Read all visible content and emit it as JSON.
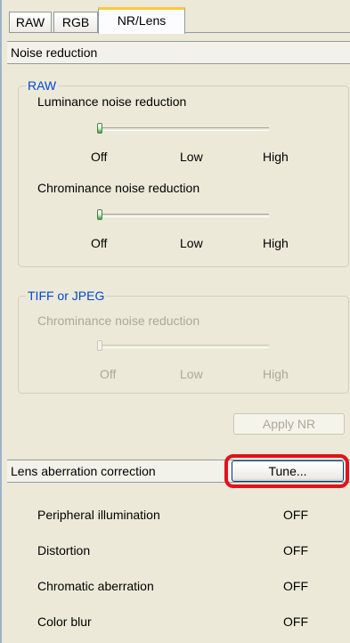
{
  "tabs": [
    {
      "label": "RAW",
      "active": false
    },
    {
      "label": "RGB",
      "active": false
    },
    {
      "label": "NR/Lens",
      "active": true
    }
  ],
  "noise_reduction": {
    "header": "Noise reduction",
    "raw_group": {
      "legend": "RAW",
      "luminance": {
        "label": "Luminance noise reduction",
        "value": "Off",
        "ticks": [
          "Off",
          "Low",
          "High"
        ]
      },
      "chrominance": {
        "label": "Chrominance noise reduction",
        "value": "Off",
        "ticks": [
          "Off",
          "Low",
          "High"
        ]
      }
    },
    "tiff_group": {
      "legend": "TIFF or JPEG",
      "chrominance": {
        "label": "Chrominance noise reduction",
        "value": "Off",
        "ticks": [
          "Off",
          "Low",
          "High"
        ],
        "enabled": false
      }
    },
    "apply_button": {
      "label": "Apply NR",
      "enabled": false
    }
  },
  "lens": {
    "header": "Lens aberration correction",
    "tune_button": "Tune...",
    "rows": [
      {
        "label": "Peripheral illumination",
        "value": "OFF"
      },
      {
        "label": "Distortion",
        "value": "OFF"
      },
      {
        "label": "Chromatic aberration",
        "value": "OFF"
      },
      {
        "label": "Color blur",
        "value": "OFF"
      }
    ]
  },
  "colors": {
    "accent": "#0046d5",
    "highlight": "#e0121c",
    "tab_active": "#ffc83c"
  }
}
